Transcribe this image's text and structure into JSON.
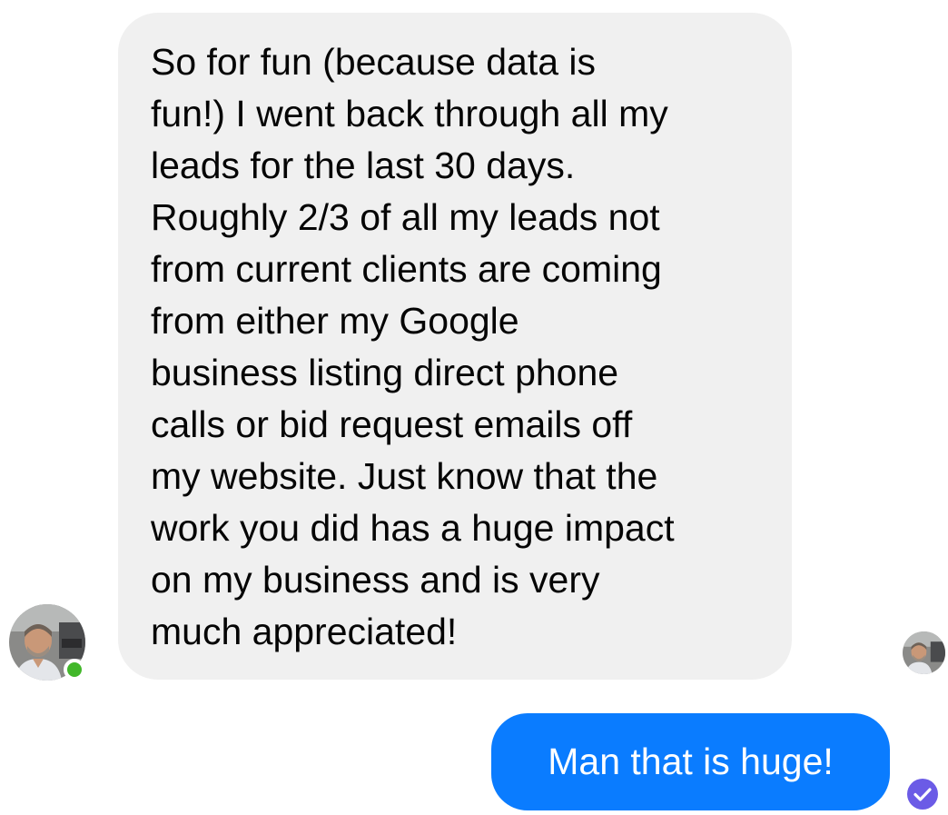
{
  "conversation": {
    "incoming_message": "So for fun (because data is\nfun!) I went back through all my\nleads for the last 30 days.\nRoughly 2/3 of all my leads not\nfrom current clients are coming\nfrom either my Google\nbusiness listing direct phone\ncalls or bid request emails off\nmy website. Just know that the\nwork you did has a huge impact\non my business and is very\nmuch appreciated!",
    "outgoing_message": "Man that is huge!"
  },
  "status": {
    "sender_online": true,
    "seen_indicator": "avatar",
    "delivery_status_icon": "checkmark-circle-icon"
  },
  "colors": {
    "incoming_bubble": "#f0f0f0",
    "outgoing_bubble": "#0a7cff",
    "online_dot": "#42b72a",
    "delivered_icon": "#6b5be6"
  }
}
